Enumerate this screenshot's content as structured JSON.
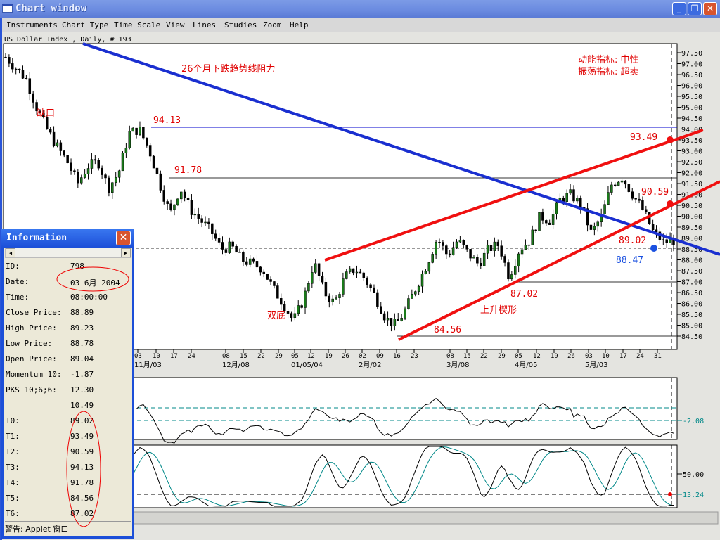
{
  "window": {
    "title": "Chart window",
    "buttons": [
      "minimize",
      "maximize",
      "close"
    ]
  },
  "menu": [
    "Instruments",
    "Chart Type",
    "Time Scale",
    "View",
    "Lines",
    "Studies",
    "Zoom",
    "Help"
  ],
  "symbol_label": "US Dollar Index , Daily, # 193",
  "annotations": {
    "trendline": "26个月下跌趋势线阻力",
    "gap": "缺口",
    "double_bottom": "双底",
    "rising_wedge": "上升楔形",
    "momentum": "动能指标:  中性",
    "oscillator": "振荡指标:  超卖",
    "levels": {
      "t3": "94.13",
      "t4": "91.78",
      "t1": "93.49",
      "t2": "90.59",
      "t0": "89.02",
      "current": "88.47",
      "t5": "84.56",
      "t6": "87.02"
    }
  },
  "info": {
    "title": "Information",
    "rows": [
      {
        "label": "ID:",
        "value": "798"
      },
      {
        "label": "Date:",
        "value": "03 6月 2004"
      },
      {
        "label": "Time:",
        "value": "08:00:00"
      },
      {
        "label": "Close Price:",
        "value": "88.89"
      },
      {
        "label": "High Price:",
        "value": "89.23"
      },
      {
        "label": "Low Price:",
        "value": "88.78"
      },
      {
        "label": "Open Price:",
        "value": "89.04"
      },
      {
        "label": "Momentum 10:",
        "value": "-1.87"
      },
      {
        "label": "PKS 10;6;6:",
        "value": "12.30"
      },
      {
        "label": "",
        "value": "10.49"
      },
      {
        "label": "T0:",
        "value": "89.02"
      },
      {
        "label": "T1:",
        "value": "93.49"
      },
      {
        "label": "T2:",
        "value": "90.59"
      },
      {
        "label": "T3:",
        "value": "94.13"
      },
      {
        "label": "T4:",
        "value": "91.78"
      },
      {
        "label": "T5:",
        "value": "84.56"
      },
      {
        "label": "T6:",
        "value": "87.02"
      }
    ],
    "warning": "警告: Applet 窗口"
  },
  "chart_data": {
    "type": "candlestick",
    "title": "US Dollar Index , Daily",
    "ylim": [
      84.5,
      97.5
    ],
    "y_ticks": [
      "97.50",
      "97.00",
      "96.50",
      "96.00",
      "95.50",
      "95.00",
      "94.50",
      "94.00",
      "93.50",
      "93.00",
      "92.50",
      "92.00",
      "91.50",
      "91.00",
      "90.50",
      "90.00",
      "89.50",
      "89.00",
      "88.50",
      "88.00",
      "87.50",
      "87.00",
      "86.50",
      "86.00",
      "85.50",
      "85.00",
      "84.50"
    ],
    "x_day_ticks": [
      "03",
      "10",
      "17",
      "24",
      "08",
      "15",
      "22",
      "29",
      "05",
      "12",
      "19",
      "26",
      "02",
      "09",
      "16",
      "23",
      "08",
      "15",
      "22",
      "29",
      "05",
      "12",
      "19",
      "26",
      "03",
      "10",
      "17",
      "24",
      "31"
    ],
    "x_month_ticks": [
      {
        "label": "11月/03",
        "at": 0
      },
      {
        "label": "12月/08",
        "at": 4
      },
      {
        "label": "01/05/04",
        "at": 8
      },
      {
        "label": "2月/02",
        "at": 12
      },
      {
        "label": "3月/08",
        "at": 16
      },
      {
        "label": "4月/05",
        "at": 20
      },
      {
        "label": "5月/03",
        "at": 24
      }
    ],
    "close_path": [
      97.3,
      96.8,
      96.3,
      95,
      94,
      93.2,
      92.5,
      91.5,
      92.3,
      92.5,
      91.3,
      92,
      93.8,
      94,
      93,
      91.5,
      90.1,
      91.3,
      90.3,
      89.8,
      89.3,
      88.5,
      88.6,
      88,
      87.8,
      87.6,
      86.7,
      86,
      85.2,
      86.2,
      87.9,
      86.5,
      86,
      87.2,
      87.6,
      87.1,
      86.3,
      85.3,
      85,
      85.8,
      86.8,
      87.8,
      89,
      88.2,
      88.9,
      88.3,
      87.8,
      88.5,
      88.7,
      87.2,
      88.5,
      88.9,
      90,
      89.8,
      90.8,
      91,
      90.5,
      89.2,
      90,
      91.5,
      91.8,
      91,
      90.3,
      89.3,
      88.8,
      88.89
    ],
    "momentum": {
      "name": "Momentum 10",
      "last": "-2.08"
    },
    "pks": {
      "name": "PKS 10;6;6",
      "level": "50.00",
      "last": "13.24"
    }
  }
}
